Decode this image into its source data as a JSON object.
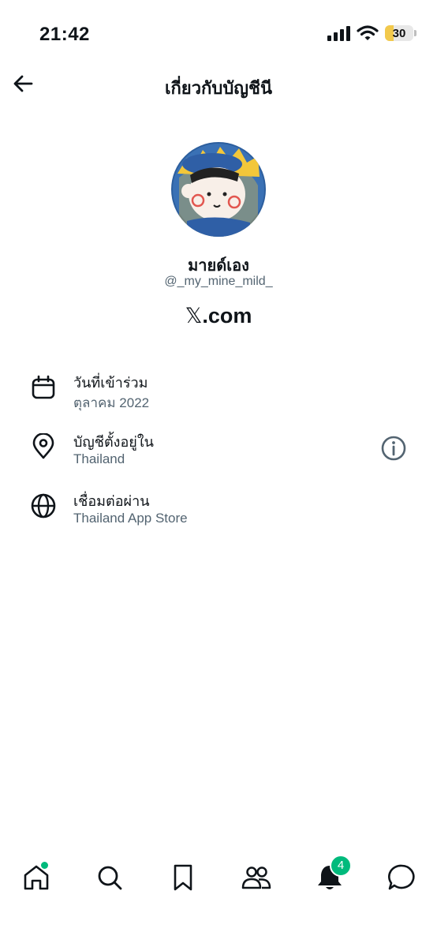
{
  "status_bar": {
    "time": "21:42",
    "battery": "30"
  },
  "header": {
    "title": "เกี่ยวกับบัญชีนี"
  },
  "profile": {
    "display_name": "มายด์เอง",
    "handle": "@_my_mine_mild_",
    "x_logo": "𝕏",
    "site": ".com"
  },
  "details": [
    {
      "label": "วันที่เข้าร่วม",
      "value": "ตุลาคม 2022",
      "icon": "calendar-icon"
    },
    {
      "label": "บัญชีตั้งอยู่ใน",
      "value": "Thailand",
      "icon": "location-pin-icon"
    },
    {
      "label": "เชื่อมต่อผ่าน",
      "value": "Thailand App Store",
      "icon": "globe-icon"
    }
  ],
  "tabbar": {
    "items": [
      "home-icon",
      "search-icon",
      "bookmark-icon",
      "communities-icon",
      "notifications-icon",
      "messages-icon"
    ],
    "notification_count": "4"
  },
  "colors": {
    "accent_green": "#00ba7c",
    "secondary_text": "#536471",
    "battery_fill": "#f2c94c"
  }
}
